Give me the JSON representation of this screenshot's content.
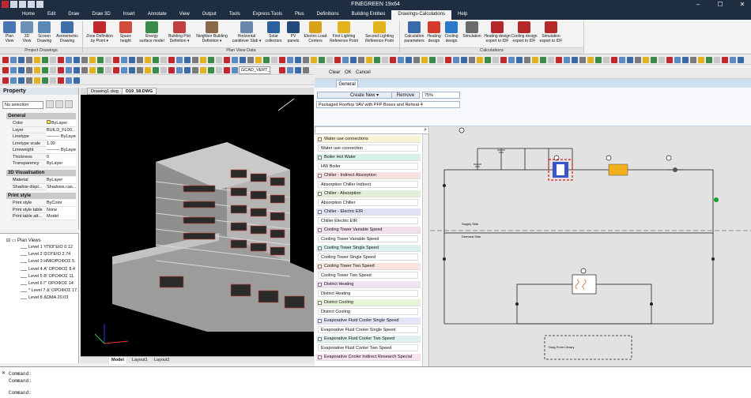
{
  "window": {
    "title": "FINEGREEN 19x64",
    "minimize": "–",
    "maximize": "☐",
    "close": "✕"
  },
  "menu": [
    {
      "label": "Home"
    },
    {
      "label": "Edit"
    },
    {
      "label": "Draw"
    },
    {
      "label": "Draw 3D"
    },
    {
      "label": "Insert"
    },
    {
      "label": "Annotate"
    },
    {
      "label": "View"
    },
    {
      "label": "Output"
    },
    {
      "label": "Tools"
    },
    {
      "label": "Express Tools"
    },
    {
      "label": "Plus"
    },
    {
      "label": "Definitions"
    },
    {
      "label": "Building Entities"
    },
    {
      "label": "Drawings-Calculations"
    },
    {
      "label": "Help"
    }
  ],
  "ribbon": {
    "group_project": "Project Drawings",
    "group_plan": "Plan View Data",
    "group_calc": "Calculations",
    "items": [
      {
        "l1": "Plan",
        "l2": "View",
        "icon": "plan-view-icon",
        "color": "#4a77b4"
      },
      {
        "l1": "3D",
        "l2": "View",
        "icon": "3d-view-icon",
        "color": "#6d8fb8"
      },
      {
        "l1": "Screen",
        "l2": "Drawing",
        "icon": "screen-drawing-icon",
        "color": "#5c8ab5"
      },
      {
        "l1": "Axonometric",
        "l2": "Drawing",
        "icon": "axonometric-icon",
        "color": "#3f6fa8"
      },
      {
        "l1": "Zone Definition",
        "l2": "by Point ▾",
        "icon": "zone-definition-icon",
        "color": "#c1272d"
      },
      {
        "l1": "Space",
        "l2": "height",
        "icon": "space-height-icon",
        "color": "#d24a3a"
      },
      {
        "l1": "Energy",
        "l2": "surface model",
        "icon": "energy-surface-icon",
        "color": "#3b8a4a"
      },
      {
        "l1": "Building Plot",
        "l2": "Definition ▾",
        "icon": "building-plot-icon",
        "color": "#c04040"
      },
      {
        "l1": "Neighbor Building",
        "l2": "Definition ▾",
        "icon": "neighbor-building-icon",
        "color": "#8a6a4a"
      },
      {
        "l1": "Horizontal",
        "l2": "cantilever Slab ▾",
        "icon": "cantilever-slab-icon",
        "color": "#6a86a8"
      },
      {
        "l1": "Solar",
        "l2": "collectors",
        "icon": "solar-collector-icon",
        "color": "#2b5f9e"
      },
      {
        "l1": "PV",
        "l2": "panels",
        "icon": "pv-panel-icon",
        "color": "#21497a"
      },
      {
        "l1": "Electric Load",
        "l2": "Centers",
        "icon": "electric-load-icon",
        "color": "#d7a21a"
      },
      {
        "l1": "First Lighting",
        "l2": "Reference Point",
        "icon": "first-lighting-icon",
        "color": "#e2b31c"
      },
      {
        "l1": "Second Lighting",
        "l2": "Reference Point",
        "icon": "second-lighting-icon",
        "color": "#e2b31c"
      },
      {
        "l1": "Calculation",
        "l2": "parameters",
        "icon": "calculation-parameters-icon",
        "color": "#3a6aa8"
      },
      {
        "l1": "Heating",
        "l2": "design",
        "icon": "heating-design-icon",
        "color": "#d63a2a"
      },
      {
        "l1": "Cooling",
        "l2": "design",
        "icon": "cooling-design-icon",
        "color": "#2a78c8"
      },
      {
        "l1": "Simulation",
        "l2": "",
        "icon": "simulation-icon",
        "color": "#6b6b6b"
      },
      {
        "l1": "Heating design",
        "l2": "export to IDF",
        "icon": "heating-idf-icon",
        "color": "#b5282a"
      },
      {
        "l1": "Cooling design",
        "l2": "export to IDF",
        "icon": "cooling-idf-icon",
        "color": "#b5282a"
      },
      {
        "l1": "Simulation",
        "l2": "export to IDF",
        "icon": "simulation-idf-icon",
        "color": "#b5282a"
      }
    ]
  },
  "layer_combo": "GCAD_VERT_E",
  "property": {
    "title": "Property",
    "selection": "No selection",
    "general": "General",
    "rows_general": [
      {
        "k": "Color",
        "v": "ByLayer"
      },
      {
        "k": "Layer",
        "v": "BUILD_FL00..."
      },
      {
        "k": "Linetype",
        "v": "——— ByLayer"
      },
      {
        "k": "Linetype scale",
        "v": "1.00"
      },
      {
        "k": "Lineweight",
        "v": "——— ByLayer"
      },
      {
        "k": "Thickness",
        "v": "0"
      },
      {
        "k": "Transparency",
        "v": "ByLayer"
      }
    ],
    "vis": "3D Visualisation",
    "rows_vis": [
      {
        "k": "Material",
        "v": "ByLayer"
      },
      {
        "k": "Shadow displ...",
        "v": "Shadows.cas..."
      }
    ],
    "print": "Print style",
    "rows_print": [
      {
        "k": "Print style",
        "v": "ByColor"
      },
      {
        "k": "Print style table",
        "v": "None"
      },
      {
        "k": "Print table att...",
        "v": "Model"
      }
    ]
  },
  "plan_views": {
    "root": "Plan Views",
    "items": [
      "Level 1 ΥΠΟΓΕΙΟ 0.12",
      "Level 2 ΙΣΟΓΕΙΟ 2.74",
      "Level 3 ΗΜΙΟΡΟΦΟΣ 5.",
      "Level 4 Α' ΟΡΟΦΟΣ 8.4",
      "Level 5 Β' ΟΡΟΦΟΣ 11.",
      "Level 6 Γ' ΟΡΟΦΟΣ 14",
      "* Level 7 Δ' ΟΡΟΦΟΣ 17.",
      "Level 8 ΔΩΜΑ 20.03"
    ]
  },
  "doc_tabs": [
    "Drawing1.dwg",
    "D19_58.DWG"
  ],
  "layout_tabs": [
    "Model",
    "Layout1",
    "Layout2"
  ],
  "fg": {
    "toolbar": [
      "Clear",
      "OK",
      "Cancel"
    ],
    "tab": "General",
    "create_new": "Create New",
    "remove": "Remove",
    "zoom": "75%",
    "component": "Packaged Rooftop VAV with PFP Boxes and Reheat 4"
  },
  "library": [
    {
      "cat": "Water use connections",
      "item": "Water use connection",
      "color": "#f7f3d4"
    },
    {
      "cat": "Boiler Hot Water",
      "item": "HW Boiler",
      "color": "#d9efe7"
    },
    {
      "cat": "Chiller - Indirect Absorption",
      "item": "Absorption Chiller Indirect",
      "color": "#f8e0e0"
    },
    {
      "cat": "Chiller - Absorption",
      "item": "Absorption Chiller",
      "color": "#e2efd9"
    },
    {
      "cat": "Chiller - Electric EIR",
      "item": "Chiller Electric EIR",
      "color": "#dfe2f3"
    },
    {
      "cat": "Cooling Tower Variable Speed",
      "item": "Cooling Tower Variable Speed",
      "color": "#f3e0ef"
    },
    {
      "cat": "Cooling Tower Single Speed",
      "item": "Cooling Tower Single Speed",
      "color": "#dcefef"
    },
    {
      "cat": "Cooling Tower Two Speed",
      "item": "Cooling Tower Two Speed",
      "color": "#f9e3df"
    },
    {
      "cat": "District Heating",
      "item": "District Heating",
      "color": "#f0e2f3"
    },
    {
      "cat": "District Cooling",
      "item": "District Cooling",
      "color": "#e8f3d9"
    },
    {
      "cat": "Evaporative Fluid Cooler Single Speed",
      "item": "Evaporative Fluid Cooler Single Speed",
      "color": "#e1e5f5"
    },
    {
      "cat": "Evaporative Fluid Cooler Two Speed",
      "item": "Evaporative Fluid Cooler Two Speed",
      "color": "#dff1ef"
    },
    {
      "cat": "Evaporative Cooler Indirect Research Special",
      "item": "",
      "color": "#f6e3ef"
    }
  ],
  "canvas": {
    "supply_label": "Supply Side",
    "demand_label": "Demand Side",
    "drag_label": "Drag From Library"
  },
  "command": {
    "line1": "Command:",
    "line2": "Command:",
    "line3": "Command:"
  }
}
